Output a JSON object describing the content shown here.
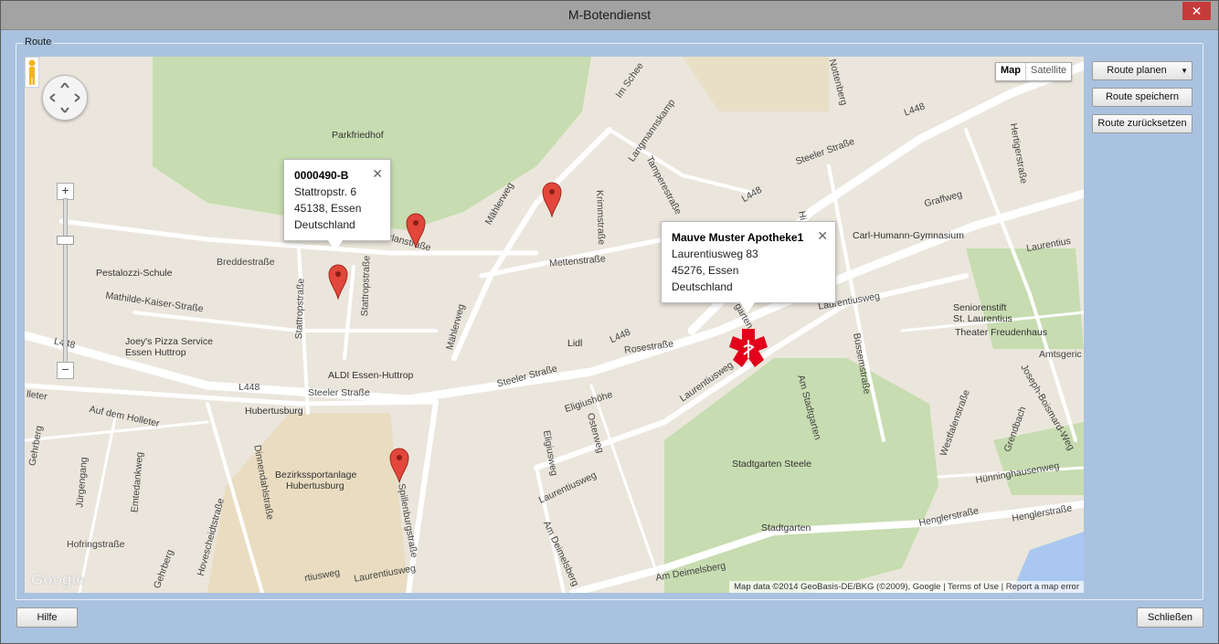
{
  "window": {
    "title": "M-Botendienst",
    "close_glyph": "✕"
  },
  "group": {
    "label": "Route"
  },
  "buttons": {
    "route_planen": "Route planen",
    "route_speichern": "Route speichern",
    "route_zuruecksetzen": "Route zurücksetzen",
    "hilfe": "Hilfe",
    "schliessen": "Schließen"
  },
  "map": {
    "type_map": "Map",
    "type_satellite": "Satellite",
    "zoom_plus": "+",
    "zoom_minus": "−",
    "google_logo": "Google",
    "copyright": "Map data ©2014 GeoBasis-DE/BKG (©2009), Google",
    "terms": "Terms of Use",
    "report": "Report a map error",
    "info_windows": [
      {
        "title": "0000490-B",
        "line1": "Stattropstr. 6",
        "line2": "45138, Essen",
        "line3": "Deutschland",
        "close": "✕"
      },
      {
        "title": "Mauve Muster Apotheke1",
        "line1": "Laurentiusweg 83",
        "line2": "45276, Essen",
        "line3": "Deutschland",
        "close": "✕"
      }
    ],
    "pois": {
      "parkfriedhof": "Parkfriedhof",
      "pestalozzi": "Pestalozzi-Schule",
      "joeys1": "Joey's Pizza Service",
      "joeys2": "Essen Huttrop",
      "aldi": "ALDI Essen-Huttrop",
      "lidl": "Lidl",
      "hubertusburg": "Hubertusburg",
      "bezirk1": "Bezirkssportanlage",
      "bezirk2": "Hubertusburg",
      "carl": "Carl-Humann-Gymnasium",
      "senioren1": "Seniorenstift",
      "senioren2": "St. Laurentius",
      "theater": "Theater Freudenhaus",
      "stadtgartensteele": "Stadtgarten Steele",
      "stadtgarten": "Stadtgarten"
    },
    "roads": {
      "breddestrasse": "Breddestraße",
      "mathilde": "Mathilde-Kaiser-Straße",
      "l448a": "L448",
      "l448b": "L448",
      "l448c": "L448",
      "l448d": "L448",
      "l448e": "L448",
      "steeler1": "Steeler Straße",
      "steeler2": "Steeler Straße",
      "steeler3": "Steeler Straße",
      "mettenstrasse": "Mettenstraße",
      "rosestrasse": "Rosestraße",
      "eligiushoehe": "Eligiushöhe",
      "laurentiusweg1": "Laurentiusweg",
      "laurentiusweg2": "Laurentiusweg",
      "laurentiusweg3": "Laurentiusweg",
      "laurentiusweg4": "Laurentiusweg",
      "laurentius5": "Laurentius",
      "mahlerweg1": "Mählerweg",
      "mahlerweg2": "Mählerweg",
      "stattropstrasse1": "Stattropstraße",
      "stattropstrasse2": "Stattropstraße",
      "orlanstrasse": "orlanstraße",
      "krimmstrasse": "Krimmstraße",
      "tamperestrasse": "Tamperestraße",
      "langmannskamp": "Langmannskamp",
      "imschee": "Im Schee",
      "graffweg": "Graffweg",
      "hertigerstrasse": "Hertigerstraße",
      "bussemstrasse": "Büssemstraße",
      "amstadtgarten": "Am Stadtgarten",
      "westfalenstrasse": "Westfalenstraße",
      "grendbach": "Grendbach",
      "josephboismard": "Joseph-Boismard-Weg",
      "hunninghausenweg": "Hünninghausenweg",
      "henglerstrasse1": "Henglerstraße",
      "henglerstrasse2": "Henglerstraße",
      "amdeimelsberg1": "Am Deimelsberg",
      "amdeimelsberg2": "Am Deimelsberg",
      "spillenburgstrasse": "Spillenburgstraße",
      "dinnendahlstrasse": "Dinnendahlstraße",
      "hovescheidtstrasse": "Hovescheidtstraße",
      "aufdemholleter": "Auf dem Holleter",
      "holleter": "lleter",
      "gehrberg1": "Gehrberg",
      "gehrberg2": "Gehrberg",
      "jurgengang": "Jürgengang",
      "emtedankweg": "Emtedankweg",
      "hofringstrasse": "Hofringstraße",
      "eligiusweg": "Eligiusweg",
      "osterweg": "Osterweg",
      "hubertusweg": "rtiusweg",
      "amtsgericht": "Amtsgeric",
      "nottenberg": "Nottenberg",
      "garten": "garten",
      "hi": "Hi"
    }
  }
}
